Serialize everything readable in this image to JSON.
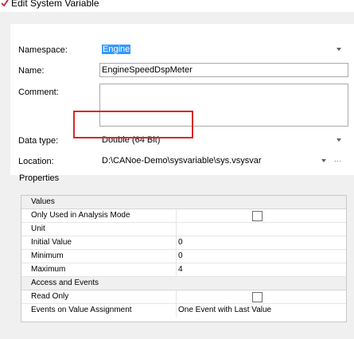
{
  "window": {
    "title": "Edit System Variable"
  },
  "form": {
    "namespace_label": "Namespace:",
    "namespace_value": "Engine",
    "name_label": "Name:",
    "name_value": "EngineSpeedDspMeter",
    "comment_label": "Comment:",
    "comment_value": "",
    "datatype_label": "Data type:",
    "datatype_value": "Double (64 Bit)",
    "location_label": "Location:",
    "location_value": "D:\\CANoe-Demo\\sysvariable\\sys.vsysvar"
  },
  "properties": {
    "label": "Properties",
    "groups": [
      {
        "title": "Values"
      },
      {
        "title": "Access and Events"
      }
    ],
    "rows": [
      {
        "name": "Only Used in Analysis Mode",
        "value": "",
        "checkbox": true,
        "checked": false
      },
      {
        "name": "Unit",
        "value": ""
      },
      {
        "name": "Initial Value",
        "value": "0"
      },
      {
        "name": "Minimum",
        "value": "0"
      },
      {
        "name": "Maximum",
        "value": "4"
      },
      {
        "name": "Read Only",
        "value": "",
        "checkbox": true,
        "checked": false
      },
      {
        "name": "Events on Value Assignment",
        "value": "One Event with Last Value"
      }
    ]
  },
  "colors": {
    "highlight": "#d9262b",
    "selection": "#3399ff"
  }
}
